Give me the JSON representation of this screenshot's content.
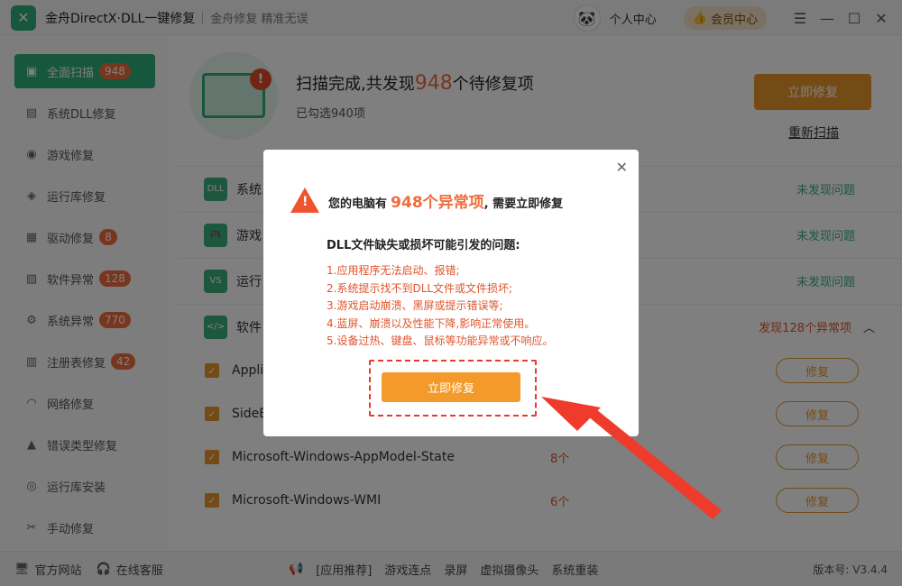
{
  "titlebar": {
    "app_title": "金舟DirectX·DLL一键修复",
    "slogan": "金舟修复 精准无误",
    "personal_center": "个人中心",
    "vip_center": "会员中心",
    "icons": [
      "menu-icon",
      "minimize-icon",
      "maximize-icon",
      "close-icon"
    ]
  },
  "sidebar": {
    "items": [
      {
        "label": "全面扫描",
        "badge": "948",
        "icon": "scan-icon",
        "active": true
      },
      {
        "label": "系统DLL修复",
        "badge": "",
        "icon": "dll-icon"
      },
      {
        "label": "游戏修复",
        "badge": "",
        "icon": "gamepad-icon"
      },
      {
        "label": "运行库修复",
        "badge": "",
        "icon": "runtime-icon"
      },
      {
        "label": "驱动修复",
        "badge": "8",
        "icon": "driver-icon"
      },
      {
        "label": "软件异常",
        "badge": "128",
        "icon": "software-icon"
      },
      {
        "label": "系统异常",
        "badge": "770",
        "icon": "gear-icon"
      },
      {
        "label": "注册表修复",
        "badge": "42",
        "icon": "registry-icon"
      },
      {
        "label": "网络修复",
        "badge": "",
        "icon": "wifi-icon"
      },
      {
        "label": "错误类型修复",
        "badge": "",
        "icon": "warning-icon"
      },
      {
        "label": "运行库安装",
        "badge": "",
        "icon": "install-icon"
      },
      {
        "label": "手动修复",
        "badge": "",
        "icon": "wrench-icon"
      }
    ]
  },
  "scan": {
    "title_prefix": "扫描完成,共发现",
    "count": "948",
    "title_suffix": "个待修复项",
    "selected": "已勾选940项",
    "fix_now": "立即修复",
    "rescan": "重新扫描"
  },
  "categories": [
    {
      "name": "系统",
      "icon_text": "DLL",
      "status": "未发现问题"
    },
    {
      "name": "游戏",
      "icon_text": "🎮",
      "status": "未发现问题"
    },
    {
      "name": "运行",
      "icon_text": "VS",
      "status": "未发现问题"
    },
    {
      "name": "软件",
      "icon_text": "</>",
      "status": "发现128个异常项"
    }
  ],
  "sub_rows": [
    {
      "name": "Appli",
      "count": "",
      "fix": "修复"
    },
    {
      "name": "SideB",
      "count": "",
      "fix": "修复"
    },
    {
      "name": "Microsoft-Windows-AppModel-State",
      "count": "8个",
      "fix": "修复"
    },
    {
      "name": "Microsoft-Windows-WMI",
      "count": "6个",
      "fix": "修复"
    }
  ],
  "footer": {
    "official_site": "官方网站",
    "online_service": "在线客服",
    "links": [
      "[应用推荐]",
      "游戏连点",
      "录屏",
      "虚拟摄像头",
      "系统重装"
    ],
    "version": "版本号: V3.4.4"
  },
  "modal": {
    "head_prefix": "您的电脑有",
    "head_count": "948个异常项",
    "head_suffix": ", 需要立即修复",
    "problem_title": "DLL文件缺失或损坏可能引发的问题:",
    "problems": [
      "1.应用程序无法启动、报错;",
      "2.系统提示找不到DLL文件或文件损坏;",
      "3.游戏启动崩溃、黑屏或提示错误等;",
      "4.蓝屏、崩溃以及性能下降,影响正常使用。",
      "5.设备过热、键盘、鼠标等功能异常或不响应。"
    ],
    "fix_button": "立即修复"
  },
  "colors": {
    "brand_green": "#2fae7a",
    "accent_orange": "#e9962a",
    "alert_red": "#e0542d"
  }
}
